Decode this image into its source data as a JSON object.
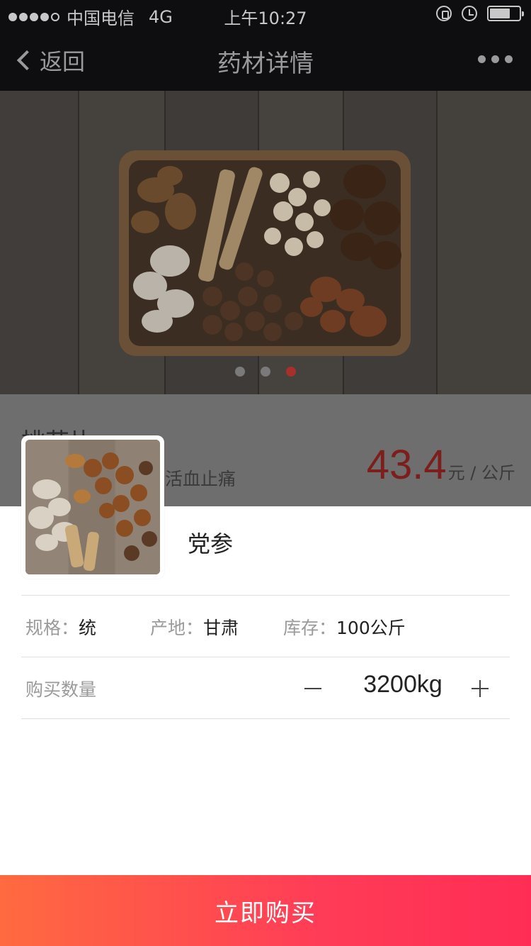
{
  "status_bar": {
    "carrier": "中国电信",
    "network": "4G",
    "time": "上午10:27"
  },
  "nav": {
    "back_label": "返回",
    "title": "药材详情"
  },
  "banner": {
    "slide_count": 3,
    "active_slide": 3
  },
  "product": {
    "name": "桃花片",
    "effect": "中 活血止痛",
    "price": "43.4",
    "price_unit": "元 / 公斤"
  },
  "sheet": {
    "name": "党参",
    "specs": {
      "spec_label": "规格：",
      "spec_value": "统",
      "origin_label": "产地：",
      "origin_value": "甘肃",
      "stock_label": "库存：",
      "stock_value": "100公斤"
    },
    "quantity": {
      "label": "购买数量",
      "value": "3200kg"
    },
    "buy_label": "立即购买"
  },
  "colors": {
    "price": "#7c1e1b",
    "buy_gradient_start": "#ff6a40",
    "buy_gradient_end": "#ff2d55",
    "active_dot": "#a8302a"
  }
}
